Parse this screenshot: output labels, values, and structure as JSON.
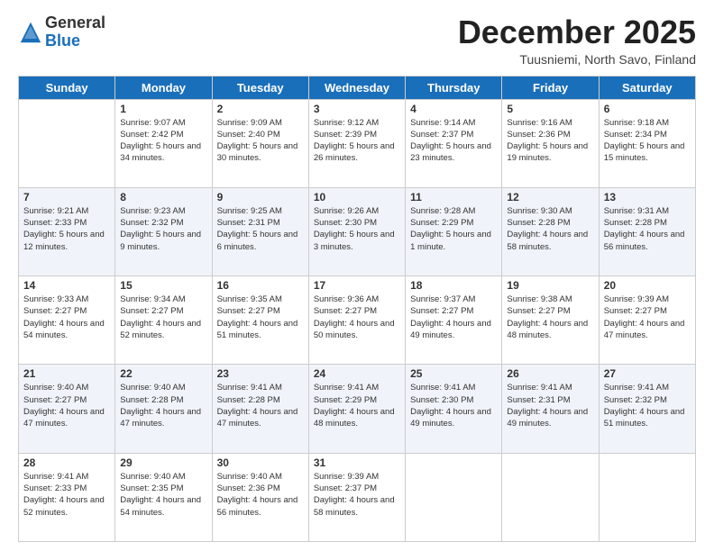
{
  "header": {
    "logo_general": "General",
    "logo_blue": "Blue",
    "month_title": "December 2025",
    "location": "Tuusniemi, North Savo, Finland"
  },
  "days_of_week": [
    "Sunday",
    "Monday",
    "Tuesday",
    "Wednesday",
    "Thursday",
    "Friday",
    "Saturday"
  ],
  "weeks": [
    [
      {
        "day": "",
        "sunrise": "",
        "sunset": "",
        "daylight": ""
      },
      {
        "day": "1",
        "sunrise": "Sunrise: 9:07 AM",
        "sunset": "Sunset: 2:42 PM",
        "daylight": "Daylight: 5 hours and 34 minutes."
      },
      {
        "day": "2",
        "sunrise": "Sunrise: 9:09 AM",
        "sunset": "Sunset: 2:40 PM",
        "daylight": "Daylight: 5 hours and 30 minutes."
      },
      {
        "day": "3",
        "sunrise": "Sunrise: 9:12 AM",
        "sunset": "Sunset: 2:39 PM",
        "daylight": "Daylight: 5 hours and 26 minutes."
      },
      {
        "day": "4",
        "sunrise": "Sunrise: 9:14 AM",
        "sunset": "Sunset: 2:37 PM",
        "daylight": "Daylight: 5 hours and 23 minutes."
      },
      {
        "day": "5",
        "sunrise": "Sunrise: 9:16 AM",
        "sunset": "Sunset: 2:36 PM",
        "daylight": "Daylight: 5 hours and 19 minutes."
      },
      {
        "day": "6",
        "sunrise": "Sunrise: 9:18 AM",
        "sunset": "Sunset: 2:34 PM",
        "daylight": "Daylight: 5 hours and 15 minutes."
      }
    ],
    [
      {
        "day": "7",
        "sunrise": "Sunrise: 9:21 AM",
        "sunset": "Sunset: 2:33 PM",
        "daylight": "Daylight: 5 hours and 12 minutes."
      },
      {
        "day": "8",
        "sunrise": "Sunrise: 9:23 AM",
        "sunset": "Sunset: 2:32 PM",
        "daylight": "Daylight: 5 hours and 9 minutes."
      },
      {
        "day": "9",
        "sunrise": "Sunrise: 9:25 AM",
        "sunset": "Sunset: 2:31 PM",
        "daylight": "Daylight: 5 hours and 6 minutes."
      },
      {
        "day": "10",
        "sunrise": "Sunrise: 9:26 AM",
        "sunset": "Sunset: 2:30 PM",
        "daylight": "Daylight: 5 hours and 3 minutes."
      },
      {
        "day": "11",
        "sunrise": "Sunrise: 9:28 AM",
        "sunset": "Sunset: 2:29 PM",
        "daylight": "Daylight: 5 hours and 1 minute."
      },
      {
        "day": "12",
        "sunrise": "Sunrise: 9:30 AM",
        "sunset": "Sunset: 2:28 PM",
        "daylight": "Daylight: 4 hours and 58 minutes."
      },
      {
        "day": "13",
        "sunrise": "Sunrise: 9:31 AM",
        "sunset": "Sunset: 2:28 PM",
        "daylight": "Daylight: 4 hours and 56 minutes."
      }
    ],
    [
      {
        "day": "14",
        "sunrise": "Sunrise: 9:33 AM",
        "sunset": "Sunset: 2:27 PM",
        "daylight": "Daylight: 4 hours and 54 minutes."
      },
      {
        "day": "15",
        "sunrise": "Sunrise: 9:34 AM",
        "sunset": "Sunset: 2:27 PM",
        "daylight": "Daylight: 4 hours and 52 minutes."
      },
      {
        "day": "16",
        "sunrise": "Sunrise: 9:35 AM",
        "sunset": "Sunset: 2:27 PM",
        "daylight": "Daylight: 4 hours and 51 minutes."
      },
      {
        "day": "17",
        "sunrise": "Sunrise: 9:36 AM",
        "sunset": "Sunset: 2:27 PM",
        "daylight": "Daylight: 4 hours and 50 minutes."
      },
      {
        "day": "18",
        "sunrise": "Sunrise: 9:37 AM",
        "sunset": "Sunset: 2:27 PM",
        "daylight": "Daylight: 4 hours and 49 minutes."
      },
      {
        "day": "19",
        "sunrise": "Sunrise: 9:38 AM",
        "sunset": "Sunset: 2:27 PM",
        "daylight": "Daylight: 4 hours and 48 minutes."
      },
      {
        "day": "20",
        "sunrise": "Sunrise: 9:39 AM",
        "sunset": "Sunset: 2:27 PM",
        "daylight": "Daylight: 4 hours and 47 minutes."
      }
    ],
    [
      {
        "day": "21",
        "sunrise": "Sunrise: 9:40 AM",
        "sunset": "Sunset: 2:27 PM",
        "daylight": "Daylight: 4 hours and 47 minutes."
      },
      {
        "day": "22",
        "sunrise": "Sunrise: 9:40 AM",
        "sunset": "Sunset: 2:28 PM",
        "daylight": "Daylight: 4 hours and 47 minutes."
      },
      {
        "day": "23",
        "sunrise": "Sunrise: 9:41 AM",
        "sunset": "Sunset: 2:28 PM",
        "daylight": "Daylight: 4 hours and 47 minutes."
      },
      {
        "day": "24",
        "sunrise": "Sunrise: 9:41 AM",
        "sunset": "Sunset: 2:29 PM",
        "daylight": "Daylight: 4 hours and 48 minutes."
      },
      {
        "day": "25",
        "sunrise": "Sunrise: 9:41 AM",
        "sunset": "Sunset: 2:30 PM",
        "daylight": "Daylight: 4 hours and 49 minutes."
      },
      {
        "day": "26",
        "sunrise": "Sunrise: 9:41 AM",
        "sunset": "Sunset: 2:31 PM",
        "daylight": "Daylight: 4 hours and 49 minutes."
      },
      {
        "day": "27",
        "sunrise": "Sunrise: 9:41 AM",
        "sunset": "Sunset: 2:32 PM",
        "daylight": "Daylight: 4 hours and 51 minutes."
      }
    ],
    [
      {
        "day": "28",
        "sunrise": "Sunrise: 9:41 AM",
        "sunset": "Sunset: 2:33 PM",
        "daylight": "Daylight: 4 hours and 52 minutes."
      },
      {
        "day": "29",
        "sunrise": "Sunrise: 9:40 AM",
        "sunset": "Sunset: 2:35 PM",
        "daylight": "Daylight: 4 hours and 54 minutes."
      },
      {
        "day": "30",
        "sunrise": "Sunrise: 9:40 AM",
        "sunset": "Sunset: 2:36 PM",
        "daylight": "Daylight: 4 hours and 56 minutes."
      },
      {
        "day": "31",
        "sunrise": "Sunrise: 9:39 AM",
        "sunset": "Sunset: 2:37 PM",
        "daylight": "Daylight: 4 hours and 58 minutes."
      },
      {
        "day": "",
        "sunrise": "",
        "sunset": "",
        "daylight": ""
      },
      {
        "day": "",
        "sunrise": "",
        "sunset": "",
        "daylight": ""
      },
      {
        "day": "",
        "sunrise": "",
        "sunset": "",
        "daylight": ""
      }
    ]
  ]
}
